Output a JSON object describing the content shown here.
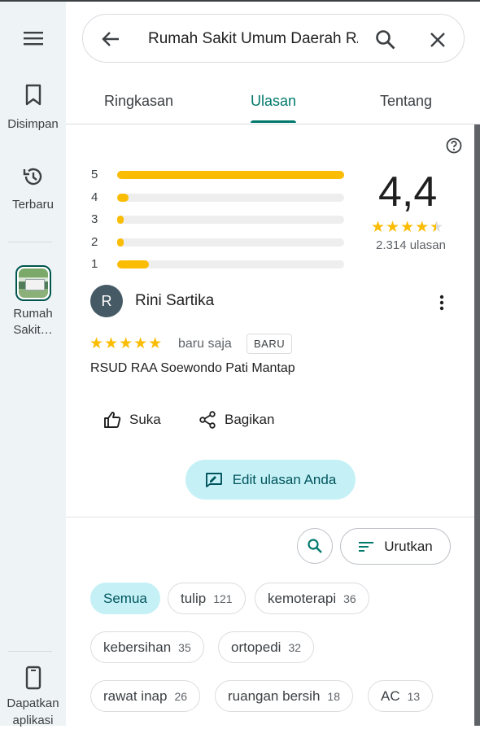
{
  "rail": {
    "menu_icon": "menu-icon",
    "saved_label": "Disimpan",
    "recent_label": "Terbaru",
    "place_label": "Rumah Sakit…",
    "get_app_label": "Dapatkan aplikasi"
  },
  "search": {
    "query": "Rumah Sakit Umum Daerah RAA Soewondo Pati"
  },
  "tabs": [
    "Ringkasan",
    "Ulasan",
    "Tentang"
  ],
  "active_tab": "Ulasan",
  "summary": {
    "rating": "4,4",
    "stars": 4.4,
    "review_count": "2.314 ulasan",
    "histogram": [
      {
        "label": "5",
        "fraction": 1.0
      },
      {
        "label": "4",
        "fraction": 0.05
      },
      {
        "label": "3",
        "fraction": 0.03
      },
      {
        "label": "2",
        "fraction": 0.025
      },
      {
        "label": "1",
        "fraction": 0.14
      }
    ]
  },
  "review": {
    "avatar_letter": "R",
    "author": "Rini Sartika",
    "stars": "★★★★★",
    "time": "baru saja",
    "badge": "BARU",
    "text": "RSUD RAA Soewondo Pati Mantap",
    "like_label": "Suka",
    "share_label": "Bagikan",
    "edit_label": "Edit ulasan Anda"
  },
  "sort_label": "Urutkan",
  "chips": [
    {
      "label": "Semua",
      "count": ""
    },
    {
      "label": "tulip",
      "count": "121"
    },
    {
      "label": "kemoterapi",
      "count": "36"
    },
    {
      "label": "kebersihan",
      "count": "35"
    },
    {
      "label": "ortopedi",
      "count": "32"
    },
    {
      "label": "rawat inap",
      "count": "26"
    },
    {
      "label": "ruangan bersih",
      "count": "18"
    },
    {
      "label": "AC",
      "count": "13"
    }
  ],
  "colors": {
    "accent": "#00796b",
    "star": "#fbbc04",
    "chip_selected_bg": "#c5f1f6"
  }
}
